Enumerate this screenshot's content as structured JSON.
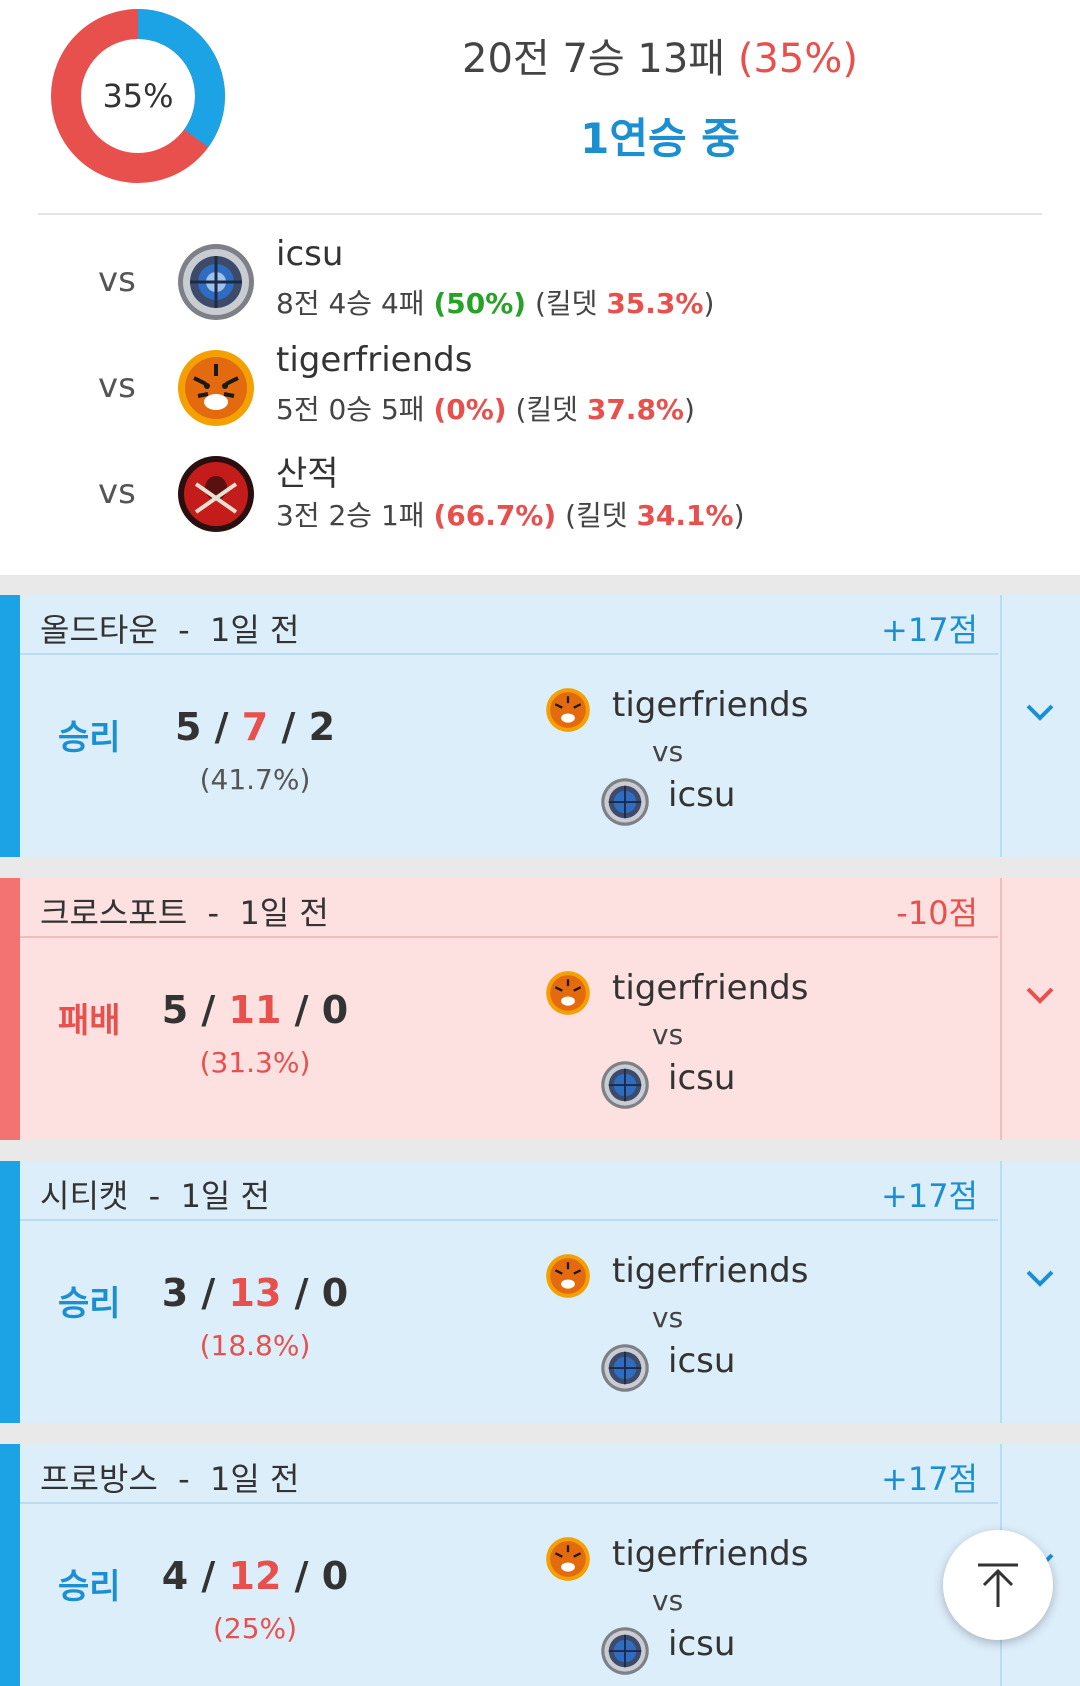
{
  "summary": {
    "win_rate_label": "35%",
    "win_fraction": 0.35,
    "record_text": "20전 7승 13패",
    "record_pct": "(35%)",
    "streak": "1연승 중"
  },
  "colors": {
    "win_blue": "#1ba3e6",
    "loss_red": "#e8504d",
    "donut_blue": "#1ba3e6",
    "donut_red": "#e8504d",
    "win_panel": "#ddeefb",
    "loss_panel": "#fde0e0"
  },
  "opponents": [
    {
      "vs": "vs",
      "logo": "icsu-logo",
      "name": "icsu",
      "record": "8전 4승 4패",
      "pct": "(50%)",
      "kd_label": "(킬뎃",
      "kd": "35.3%",
      "kd_close": ")"
    },
    {
      "vs": "vs",
      "logo": "tiger-logo",
      "name": "tigerfriends",
      "record": "5전 0승 5패",
      "pct": "(0%)",
      "kd_label": "(킬뎃",
      "kd": "37.8%",
      "kd_close": ")"
    },
    {
      "vs": "vs",
      "logo": "pirate-logo",
      "name": "산적",
      "record": "3전 2승 1패",
      "pct": "(66.7%)",
      "kd_label": "(킬뎃",
      "kd": "34.1%",
      "kd_close": ")"
    }
  ],
  "matches": [
    {
      "map": "올드타운",
      "sep": "-",
      "time": "1일 전",
      "points": "+17점",
      "result": "승리",
      "kills": "5",
      "deaths": "7",
      "assists": "2",
      "slash": "/",
      "kill_pct": "(41.7%)",
      "team1": "tigerfriends",
      "vs": "vs",
      "team2": "icsu"
    },
    {
      "map": "크로스포트",
      "sep": "-",
      "time": "1일 전",
      "points": "-10점",
      "result": "패배",
      "kills": "5",
      "deaths": "11",
      "assists": "0",
      "slash": "/",
      "kill_pct": "(31.3%)",
      "team1": "tigerfriends",
      "vs": "vs",
      "team2": "icsu"
    },
    {
      "map": "시티캣",
      "sep": "-",
      "time": "1일 전",
      "points": "+17점",
      "result": "승리",
      "kills": "3",
      "deaths": "13",
      "assists": "0",
      "slash": "/",
      "kill_pct": "(18.8%)",
      "team1": "tigerfriends",
      "vs": "vs",
      "team2": "icsu"
    },
    {
      "map": "프로방스",
      "sep": "-",
      "time": "1일 전",
      "points": "+17점",
      "result": "승리",
      "kills": "4",
      "deaths": "12",
      "assists": "0",
      "slash": "/",
      "kill_pct": "(25%)",
      "team1": "tigerfriends",
      "vs": "vs",
      "team2": "icsu"
    }
  ],
  "icons": {
    "expand": "chevron-down-icon",
    "scroll_top": "arrow-up-to-top-icon"
  }
}
